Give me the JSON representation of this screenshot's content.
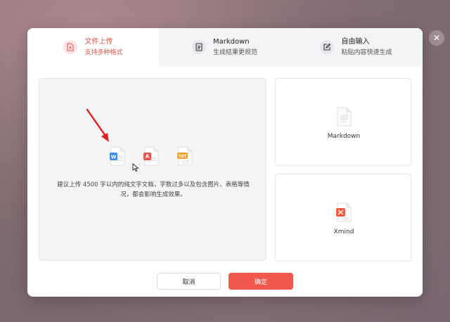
{
  "tabs": [
    {
      "title": "文件上传",
      "subtitle": "支持多种格式",
      "icon": "file-upload-icon",
      "active": true
    },
    {
      "title": "Markdown",
      "subtitle": "生成结果更规范",
      "icon": "document-icon",
      "active": false
    },
    {
      "title": "自由输入",
      "subtitle": "粘贴内容快速生成",
      "icon": "edit-icon",
      "active": false
    }
  ],
  "upload": {
    "hint": "建议上传 4500 字以内的纯文字文档，字数过多以及包含图片、表格等情况，都会影响生成效果。",
    "file_types": [
      "W",
      "PDF",
      "TXT"
    ]
  },
  "options": {
    "markdown_label": "Markdown",
    "xmind_label": "Xmind"
  },
  "buttons": {
    "cancel": "取消",
    "confirm": "确定"
  },
  "close_label": "✕",
  "colors": {
    "accent": "#f0584e",
    "word": "#3d8be8",
    "pdf": "#e9544a",
    "txt": "#f2a33a"
  }
}
